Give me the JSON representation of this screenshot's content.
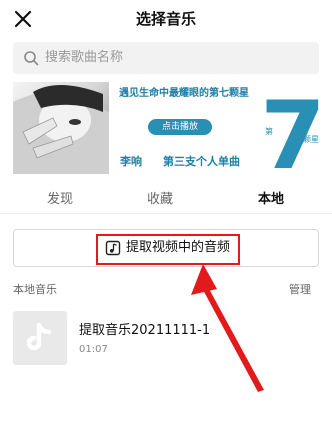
{
  "header": {
    "title": "选择音乐",
    "close_icon": "close-icon"
  },
  "search": {
    "placeholder": "搜索歌曲名称",
    "icon": "search-icon"
  },
  "banner": {
    "slogan": "遇见生命中最耀眼的第七颗星",
    "play_label": "点击播放",
    "singer": "李响",
    "album": "第三支个人单曲",
    "big_number": "7",
    "side_left": "第",
    "side_right": "颗星",
    "accent_color": "#2a8fb4"
  },
  "tabs": [
    {
      "label": "发现",
      "active": false
    },
    {
      "label": "收藏",
      "active": false
    },
    {
      "label": "本地",
      "active": true
    }
  ],
  "extract": {
    "label": "提取视频中的音频",
    "icon": "video-music-icon",
    "highlight_color": "#e11b1b"
  },
  "local": {
    "section_label": "本地音乐",
    "manage_label": "管理",
    "tracks": [
      {
        "title": "提取音乐20211111-1",
        "duration": "01:07",
        "icon": "music-note-icon"
      }
    ]
  }
}
